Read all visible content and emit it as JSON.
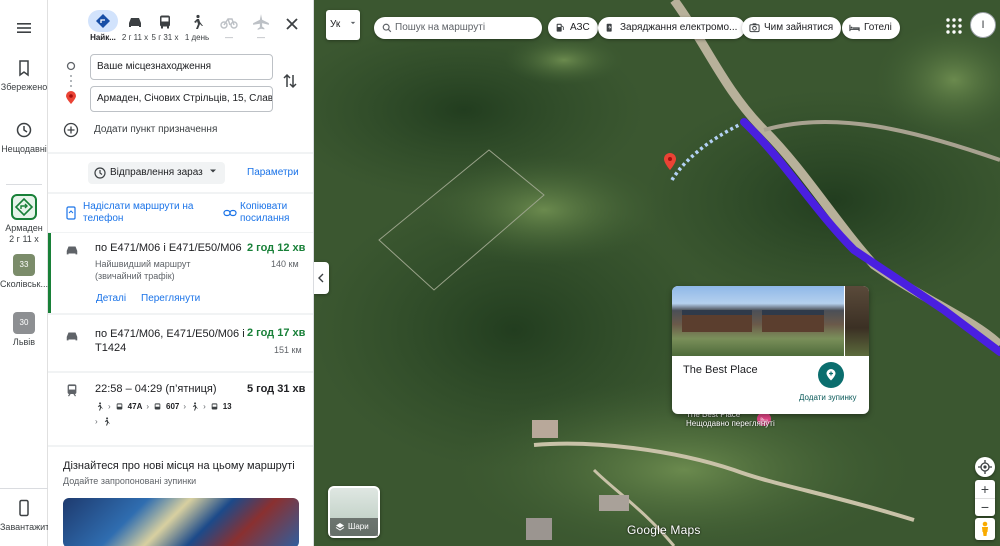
{
  "rail": {
    "menu_icon": "hamburger-menu-icon",
    "saved": "Збережено",
    "recent": "Нещодавні",
    "armaden": "Армаден",
    "armaden_time": "2 г 11 х",
    "skole": "Сколівськ...",
    "lviv": "Львів",
    "lviv_temp": "30",
    "skole_temp": "33",
    "download_app": "Завантажити..."
  },
  "modes": {
    "best": "Найк...",
    "car": "2 г 11 х",
    "transit": "5 г 31 х",
    "walk": "1 день",
    "bike": "—",
    "flight": "—"
  },
  "directions": {
    "origin": "Ваше місцезнаходження",
    "destination": "Армаден, Січових Стрільців, 15, Славськ",
    "add_destination": "Додати пункт призначення",
    "depart_now": "Відправлення зараз",
    "options": "Параметри"
  },
  "share": {
    "send_to_phone": "Надіслати маршрути на телефон",
    "copy_links": "Копіювати посилання"
  },
  "routes": [
    {
      "via": "по E471/M06 і E471/E50/M06",
      "duration": "2 год 12 хв",
      "desc": "Найшвидший маршрут (звичайний трафік)",
      "distance": "140 км",
      "details": "Деталі",
      "preview": "Переглянути"
    },
    {
      "via": "по E471/M06, E471/E50/M06 і T1424",
      "duration": "2 год 17 хв",
      "distance": "151 км"
    }
  ],
  "transit": {
    "time": "22:58 – 04:29 (п’ятниця)",
    "duration": "5 год 31 хв",
    "bus1": "47A",
    "bus2": "607",
    "train": "13"
  },
  "discover": {
    "title": "Дізнайтеся про нові місця на цьому маршруті",
    "subtitle": "Додайте запропоновані зупинки"
  },
  "map": {
    "lang": "Ук",
    "search_placeholder": "Пошук на маршруті",
    "chips": [
      "АЗС",
      "Заряджання електромо...",
      "Чим зайнятися",
      "Готелі"
    ],
    "avatar": "І",
    "place_name": "The Best Place",
    "add_stop": "Додати зупинку",
    "place_label": "The Best Place",
    "place_sublabel": "Нещодавно переглянуті",
    "layers": "Шари",
    "logo": "Google Maps",
    "accent": "#1a73e8",
    "route_color": "#4a1fe0"
  }
}
